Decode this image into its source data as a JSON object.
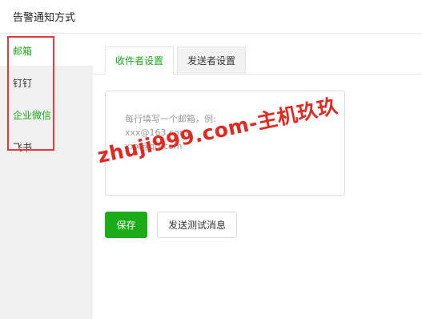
{
  "header": {
    "title": "告警通知方式"
  },
  "sidebar": {
    "items": [
      {
        "label": "邮箱"
      },
      {
        "label": "钉钉"
      },
      {
        "label": "企业微信"
      },
      {
        "label": "飞书"
      }
    ]
  },
  "tabs": [
    {
      "label": "收件者设置"
    },
    {
      "label": "发送者设置"
    }
  ],
  "recipients": {
    "placeholder_lines": [
      "每行填写一个邮箱，例:",
      "xxx@163.com",
      "xxx@qq.com"
    ]
  },
  "buttons": {
    "save_label": "保存",
    "test_label": "发送测试消息"
  },
  "watermark": {
    "text": "zhuji999.com-主机玖玖"
  },
  "colors": {
    "accent_green": "#1aad19",
    "highlight_red": "#e63939",
    "watermark_red": "#e5281f"
  }
}
